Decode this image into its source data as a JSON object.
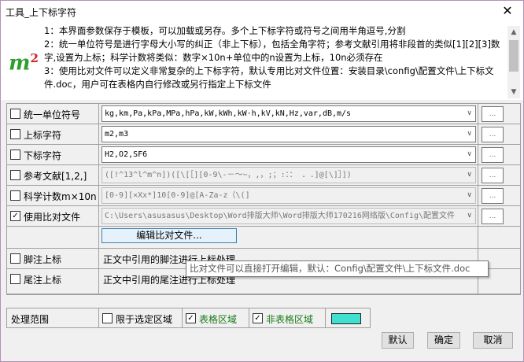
{
  "window": {
    "title": "工具_上下标字符",
    "close_icon": "close-icon"
  },
  "info": {
    "logo": "m",
    "logo_sup": "2",
    "lines": [
      "1：本界面参数保存于模板，可以加载或另存。多个上下标字符或符号之间用半角逗号,分割",
      "2：统一单位符号是进行字母大小写的纠正（非上下标），包括全角字符；参考文献引用将非段首的类似[1][2][3]数字,设置为上标；科学计数将类似：数字×10n+单位中的n设置为上标，10n必须存在",
      "3：使用比对文件可以定义非常复杂的上下标字符，默认专用比对文件位置：安装目录\\config\\配置文件\\上下标文件.doc，用户可在表格内自行修改或另行指定上下标文件"
    ]
  },
  "rows": [
    {
      "label": "统一单位符号",
      "checked": false,
      "value": "kg,km,Pa,kPa,MPa,hPa,kW,kWh,kW·h,kV,kN,Hz,var,dB,m/s",
      "disabled": false,
      "more": "..."
    },
    {
      "label": "上标字符",
      "checked": false,
      "value": "m2,m3",
      "disabled": false,
      "more": "..."
    },
    {
      "label": "下标字符",
      "checked": false,
      "value": "H2,O2,SF6",
      "disabled": false,
      "more": "..."
    },
    {
      "label": "参考文献[1,2,]",
      "checked": false,
      "value": "([!^13^l^m^n])([\\[［][0-9\\-－～~，,，;；:：：  ．.]@[\\]］])",
      "disabled": true,
      "more": "..."
    },
    {
      "label": "科学计数m×10n",
      "checked": false,
      "value": "[0-9][×Xx*]10[0-9]@[A-Za-z（\\(]",
      "disabled": true,
      "more": "..."
    },
    {
      "label": "使用比对文件",
      "checked": true,
      "value": "C:\\Users\\asusasus\\Desktop\\Word排版大师\\Word排版大师170216网络版\\Config\\配置文件",
      "disabled": true,
      "more": "..."
    }
  ],
  "edit_button": "编辑比对文件...",
  "footnote": {
    "label": "脚注上标",
    "checked": false,
    "desc": "正文中引用的脚注进行上标处理"
  },
  "endnote": {
    "label": "尾注上标",
    "checked": false,
    "desc": "正文中引用的尾注进行上标处理"
  },
  "tooltip": "比对文件可以直接打开编辑，默认：Config\\配置文件\\上下标文件.doc",
  "range": {
    "label": "处理范围",
    "selection": {
      "label": "限于选定区域",
      "checked": false
    },
    "table": {
      "label": "表格区域",
      "checked": true
    },
    "nontable": {
      "label": "非表格区域",
      "checked": true
    },
    "color": "#40e0d0"
  },
  "buttons": {
    "default": "默认",
    "ok": "确定",
    "cancel": "取消"
  }
}
